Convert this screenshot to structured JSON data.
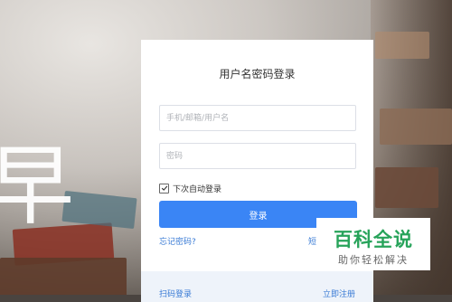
{
  "background": {
    "headline_char": "早"
  },
  "login": {
    "title": "用户名密码登录",
    "username_placeholder": "手机/邮箱/用户名",
    "password_placeholder": "密码",
    "remember_label": "下次自动登录",
    "remember_checked": true,
    "submit_label": "登录",
    "forgot_label": "忘记密码?",
    "sms_label": "短"
  },
  "footer": {
    "scan_label": "扫码登录",
    "register_label": "立即注册"
  },
  "watermark": {
    "main": "百科全说",
    "sub": "助你轻松解决"
  },
  "colors": {
    "accent": "#3a85f5",
    "link": "#3a7bd5",
    "watermark_green": "#27a35a"
  }
}
